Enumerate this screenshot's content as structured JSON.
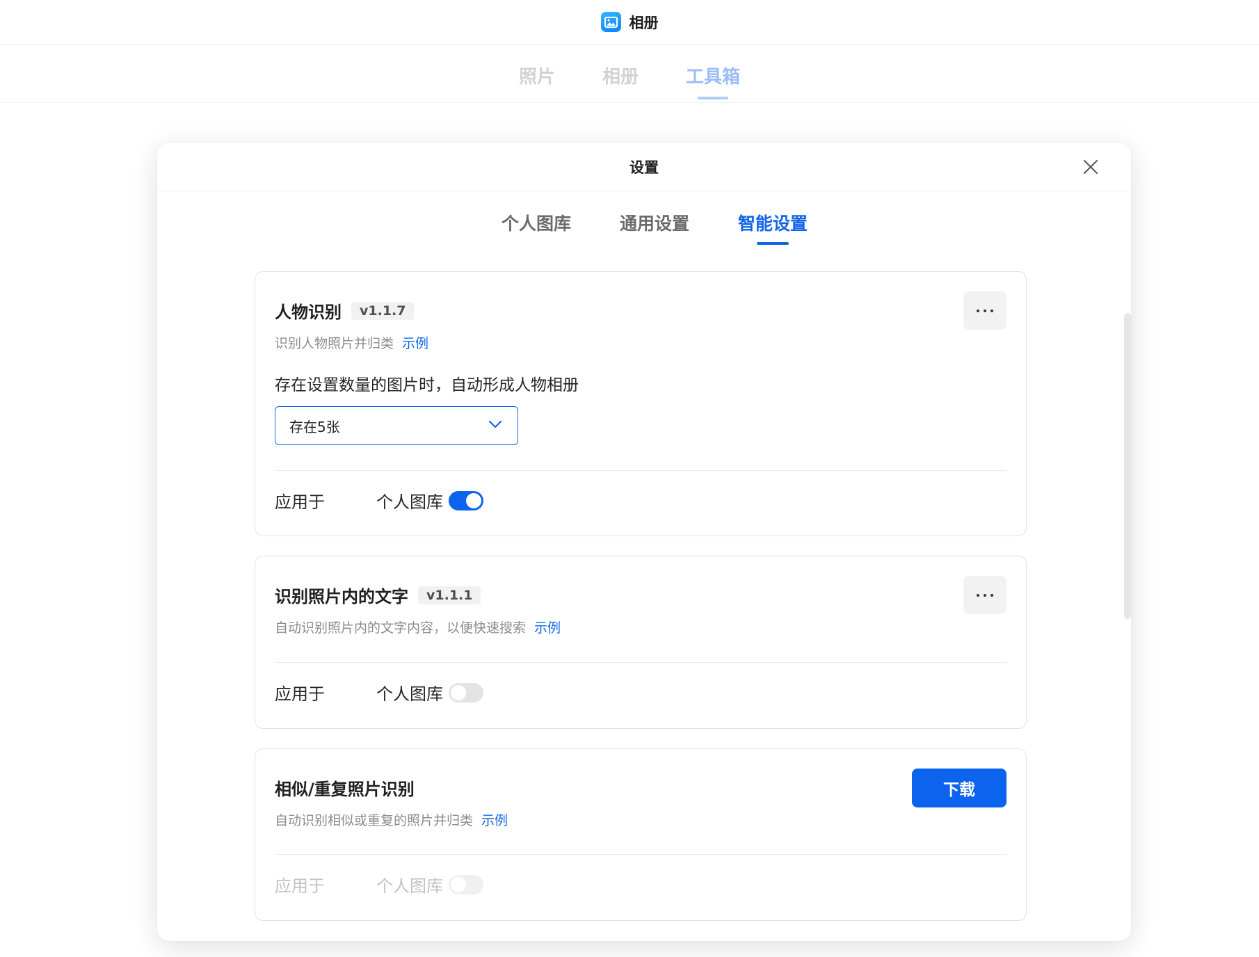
{
  "app": {
    "title": "相册",
    "tabs": [
      {
        "label": "照片"
      },
      {
        "label": "相册"
      },
      {
        "label": "工具箱",
        "active": true
      }
    ]
  },
  "modal": {
    "title": "设置",
    "tabs": [
      {
        "label": "个人图库"
      },
      {
        "label": "通用设置"
      },
      {
        "label": "智能设置",
        "active": true
      }
    ]
  },
  "cards": {
    "face": {
      "title": "人物识别",
      "version": "v1.1.7",
      "description": "识别人物照片并归类",
      "example_label": "示例",
      "threshold_label": "存在设置数量的图片时，自动形成人物相册",
      "select_value": "存在5张",
      "apply_label": "应用于",
      "apply_target": "个人图库",
      "enabled": true
    },
    "ocr": {
      "title": "识别照片内的文字",
      "version": "v1.1.1",
      "description": "自动识别照片内的文字内容，以便快速搜索",
      "example_label": "示例",
      "apply_label": "应用于",
      "apply_target": "个人图库",
      "enabled": false
    },
    "similar": {
      "title": "相似/重复照片识别",
      "description": "自动识别相似或重复的照片并归类",
      "example_label": "示例",
      "download_label": "下载",
      "apply_label": "应用于",
      "apply_target": "个人图库",
      "enabled": false,
      "disabled": true
    }
  },
  "colors": {
    "accent": "#0b63ee",
    "active_tab": "#1166e8",
    "muted_text": "#8c8c8c"
  }
}
